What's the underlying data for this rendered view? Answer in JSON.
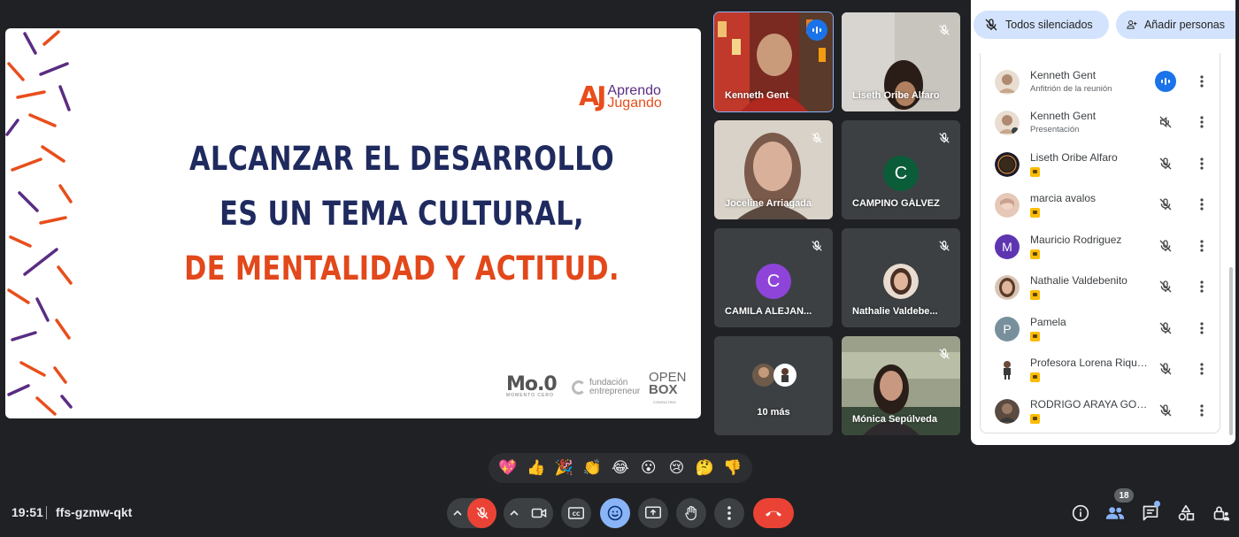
{
  "slide": {
    "logo_mark": "AJ",
    "logo_line1": "Aprendo",
    "logo_line2": "Jugando",
    "line1": "ALCANZAR EL DESARROLLO",
    "line2": "ES UN TEMA CULTURAL,",
    "line3": "DE MENTALIDAD Y ACTITUD.",
    "sponsor1": "Mo.0",
    "sponsor1_sub": "MOMENTO CERO",
    "sponsor2_line1": "fundación",
    "sponsor2_line2": "entrepreneur",
    "sponsor3_line1": "OPEN",
    "sponsor3_line2": "BOX",
    "sponsor3_sub": "CONSULTING",
    "colors": {
      "dark": "#1f2a5e",
      "orange": "#e2481b",
      "purple": "#5a2c83"
    }
  },
  "tiles": [
    {
      "name": "Kenneth Gent",
      "mic": "speaking"
    },
    {
      "name": "Liseth Oribe Alfaro",
      "mic": "muted"
    },
    {
      "name": "Joceline Arriagada",
      "mic": "muted"
    },
    {
      "name": "CAMPINO GÁLVEZ",
      "mic": "muted",
      "initial": "C",
      "avatar_color": "#0b5d3a"
    },
    {
      "name": "CAMILA ALEJAN...",
      "mic": "muted",
      "initial": "C",
      "avatar_color": "#8e44d8"
    },
    {
      "name": "Nathalie Valdebe...",
      "mic": "muted"
    },
    {
      "name": "10 más"
    },
    {
      "name": "Mónica Sepúlveda",
      "mic": "muted"
    }
  ],
  "reactions": [
    "💖",
    "👍",
    "🎉",
    "👏",
    "😂",
    "😮",
    "😢",
    "🤔",
    "👎"
  ],
  "bottom": {
    "time": "19:51",
    "meeting_code": "ffs-gzmw-qkt",
    "participant_count": "18"
  },
  "panel": {
    "mute_all_label": "Todos silenciados",
    "add_people_label": "Añadir personas",
    "participants": [
      {
        "name": "Kenneth Gent",
        "sub": "Anfitrión de la reunión",
        "mic": "speaking"
      },
      {
        "name": "Kenneth Gent",
        "sub": "Presentación",
        "mic": "sound-off"
      },
      {
        "name": "Liseth Oribe Alfaro",
        "mic": "muted"
      },
      {
        "name": "marcia avalos",
        "mic": "muted"
      },
      {
        "name": "Mauricio Rodriguez",
        "mic": "muted",
        "initial": "M",
        "avatar_color": "#5e35b1"
      },
      {
        "name": "Nathalie Valdebenito",
        "mic": "muted"
      },
      {
        "name": "Pamela",
        "mic": "muted",
        "initial": "P",
        "avatar_color": "#78909c"
      },
      {
        "name": "Profesora Lorena Riquel...",
        "mic": "muted"
      },
      {
        "name": "RODRIGO ARAYA GON...",
        "mic": "muted"
      }
    ]
  }
}
